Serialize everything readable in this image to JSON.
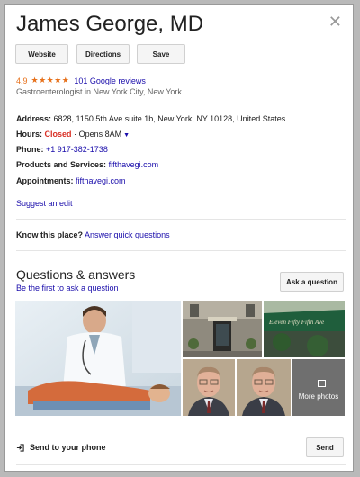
{
  "header": {
    "title": "James George, MD",
    "close_icon": "close-icon",
    "buttons": {
      "website": "Website",
      "directions": "Directions",
      "save": "Save"
    }
  },
  "rating": {
    "value": "4.9",
    "stars": "★★★★★",
    "star_count": 5,
    "reviews": "101 Google reviews"
  },
  "subtitle": "Gastroenterologist in New York City, New York",
  "info": {
    "address_label": "Address:",
    "address_value": "6828, 1150 5th Ave suite 1b, New York, NY 10128, United States",
    "hours_label": "Hours:",
    "hours_status": "Closed",
    "hours_sep": "·",
    "hours_open": "Opens 8AM",
    "phone_label": "Phone:",
    "phone_value": "+1 917-382-1738",
    "products_label": "Products and Services:",
    "products_value": "fifthavegi.com",
    "appointments_label": "Appointments:",
    "appointments_value": "fifthavegi.com",
    "suggest_edit": "Suggest an edit"
  },
  "know": {
    "label": "Know this place?",
    "link": "Answer quick questions"
  },
  "qa": {
    "title": "Questions & answers",
    "subtitle": "Be the first to ask a question",
    "ask_button": "Ask a question"
  },
  "photos": {
    "more_label": "More photos",
    "building_sign": "Eleven Fifty Fifth Ave"
  },
  "send": {
    "label": "Send to your phone",
    "button": "Send"
  },
  "colors": {
    "link": "#1a0dab",
    "rating": "#e7711b",
    "closed": "#d93025"
  }
}
